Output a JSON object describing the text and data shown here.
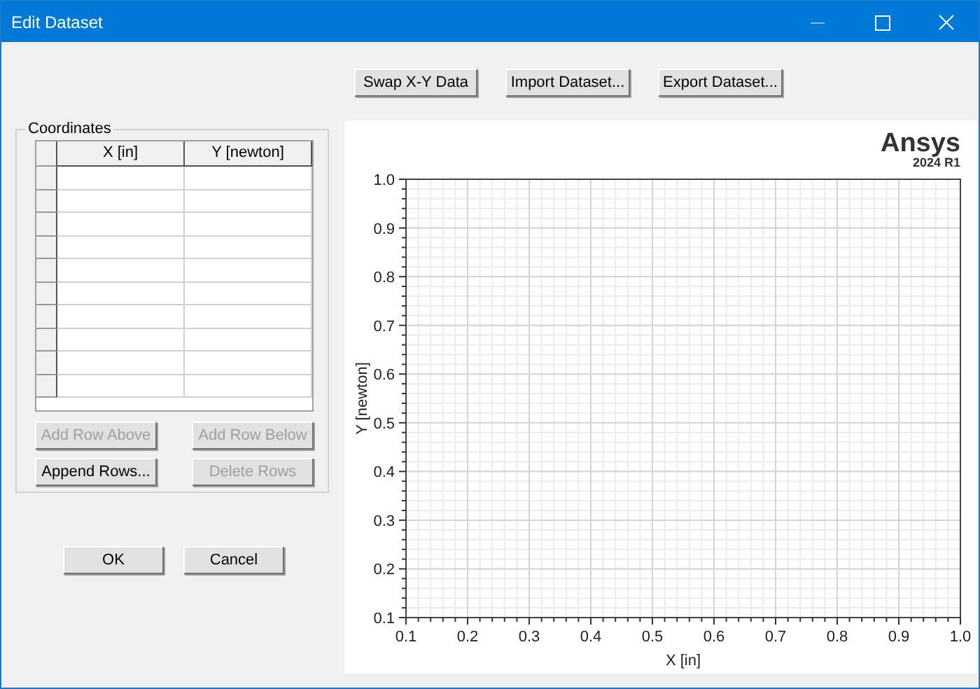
{
  "window": {
    "title": "Edit Dataset",
    "controls": [
      {
        "kind": "minimize",
        "disabled": true
      },
      {
        "kind": "maximize",
        "disabled": false
      },
      {
        "kind": "close",
        "disabled": false
      }
    ]
  },
  "toolbar": [
    {
      "label": "Swap X-Y Data",
      "disabled": false
    },
    {
      "label": "Import Dataset...",
      "disabled": false
    },
    {
      "label": "Export Dataset...",
      "disabled": false
    }
  ],
  "coordinates": {
    "title": "Coordinates",
    "columns": [
      "X [in]",
      "Y [newton]"
    ],
    "buttons": [
      {
        "label": "Add Row Above",
        "disabled": true
      },
      {
        "label": "Add Row Below",
        "disabled": true
      },
      {
        "label": "Append Rows...",
        "disabled": false
      },
      {
        "label": "Delete Rows",
        "disabled": true
      }
    ]
  },
  "dialog_buttons": [
    "OK",
    "Cancel"
  ],
  "plot": {
    "logo": "Ansys",
    "version": "2024 R1",
    "chart_data": {
      "type": "line",
      "grid": true,
      "xlabel": "X [in]",
      "ylabel": "Y [newton]",
      "xlim": [
        0.1,
        1.0
      ],
      "ylim": [
        0.1,
        1.0
      ],
      "xticks": [
        {
          "value": 0.1,
          "label": "0.1"
        },
        {
          "value": 0.2,
          "label": "0.2"
        },
        {
          "value": 0.3,
          "label": "0.3"
        },
        {
          "value": 0.4,
          "label": "0.4"
        },
        {
          "value": 0.5,
          "label": "0.5"
        },
        {
          "value": 0.6,
          "label": "0.6"
        },
        {
          "value": 0.7,
          "label": "0.7"
        },
        {
          "value": 0.8,
          "label": "0.8"
        },
        {
          "value": 0.9,
          "label": "0.9"
        },
        {
          "value": 1.0,
          "label": "1.0"
        }
      ],
      "yticks": [
        {
          "value": 0.1,
          "label": "0.1"
        },
        {
          "value": 0.2,
          "label": "0.2"
        },
        {
          "value": 0.3,
          "label": "0.3"
        },
        {
          "value": 0.4,
          "label": "0.4"
        },
        {
          "value": 0.5,
          "label": "0.5"
        },
        {
          "value": 0.6,
          "label": "0.6"
        },
        {
          "value": 0.7,
          "label": "0.7"
        },
        {
          "value": 0.8,
          "label": "0.8"
        },
        {
          "value": 0.9,
          "label": "0.9"
        },
        {
          "value": 1.0,
          "label": "1.0"
        }
      ]
    }
  }
}
